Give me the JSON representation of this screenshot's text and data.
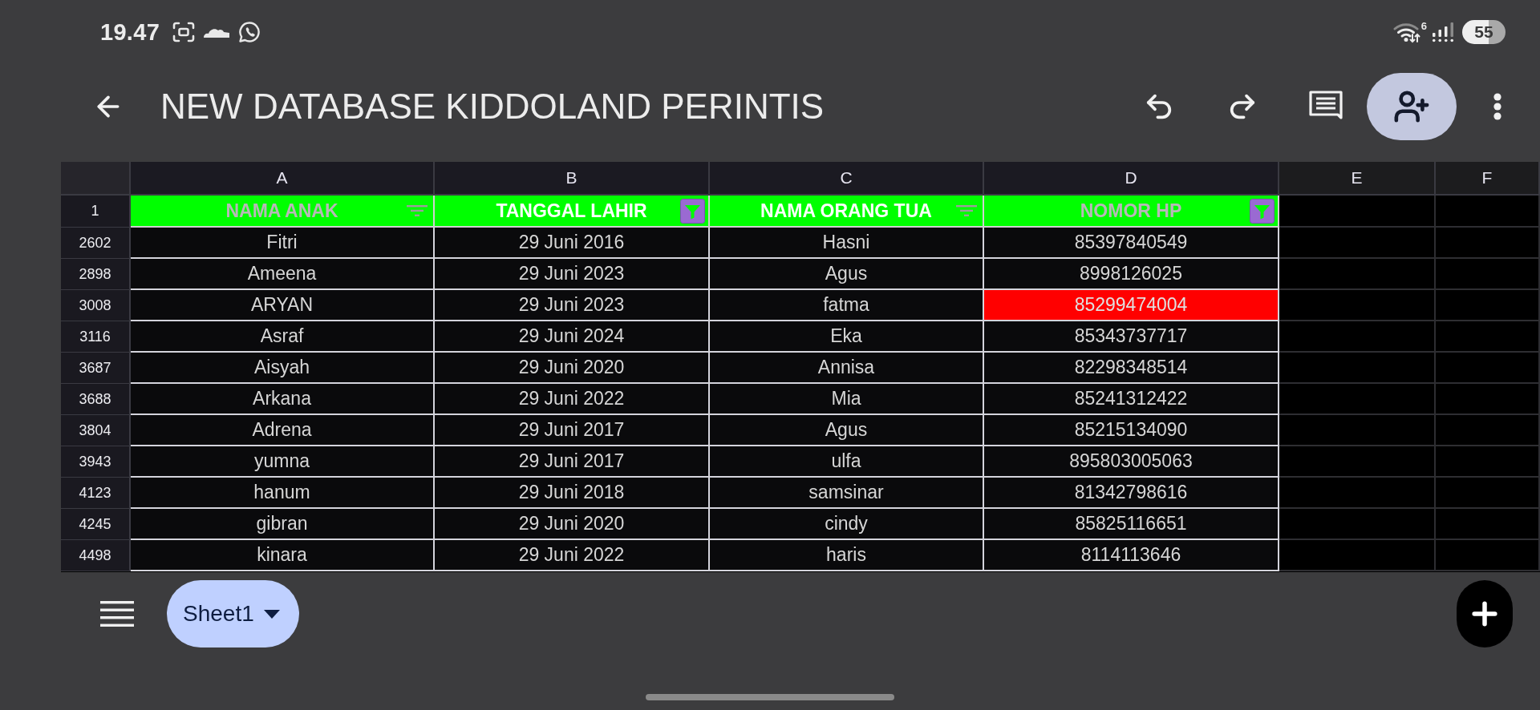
{
  "status_bar": {
    "time": "19.47",
    "network_badge": "6",
    "battery": "55"
  },
  "toolbar": {
    "title": "NEW DATABASE KIDDOLAND PERINTIS"
  },
  "sheet": {
    "columns": [
      "A",
      "B",
      "C",
      "D",
      "E",
      "F"
    ],
    "header_row": {
      "row": "1",
      "cells": [
        {
          "text": "NAMA ANAK",
          "color": "#b8b8b8",
          "filter_active": false
        },
        {
          "text": "TANGGAL LAHIR",
          "color": "#ffffff",
          "filter_active": true
        },
        {
          "text": "NAMA ORANG TUA",
          "color": "#ffffff",
          "filter_active": false
        },
        {
          "text": "NOMOR HP",
          "color": "#b8b8b8",
          "filter_active": true
        }
      ]
    },
    "rows": [
      {
        "row": "2602",
        "cells": [
          {
            "text": "Fitri",
            "highlighted": false
          },
          {
            "text": "29 Juni 2016",
            "highlighted": false
          },
          {
            "text": "Hasni",
            "highlighted": false
          },
          {
            "text": "85397840549",
            "highlighted": false
          }
        ]
      },
      {
        "row": "2898",
        "cells": [
          {
            "text": "Ameena",
            "highlighted": false
          },
          {
            "text": "29 Juni 2023",
            "highlighted": false
          },
          {
            "text": "Agus",
            "highlighted": false
          },
          {
            "text": "8998126025",
            "highlighted": false
          }
        ]
      },
      {
        "row": "3008",
        "cells": [
          {
            "text": "ARYAN",
            "highlighted": false
          },
          {
            "text": "29 Juni 2023",
            "highlighted": false
          },
          {
            "text": "fatma",
            "highlighted": false
          },
          {
            "text": "85299474004",
            "highlighted": true
          }
        ]
      },
      {
        "row": "3116",
        "cells": [
          {
            "text": "Asraf",
            "highlighted": false
          },
          {
            "text": "29 Juni 2024",
            "highlighted": false
          },
          {
            "text": "Eka",
            "highlighted": false
          },
          {
            "text": "85343737717",
            "highlighted": false
          }
        ]
      },
      {
        "row": "3687",
        "cells": [
          {
            "text": "Aisyah",
            "highlighted": false
          },
          {
            "text": "29 Juni 2020",
            "highlighted": false
          },
          {
            "text": "Annisa",
            "highlighted": false
          },
          {
            "text": "82298348514",
            "highlighted": false
          }
        ]
      },
      {
        "row": "3688",
        "cells": [
          {
            "text": "Arkana",
            "highlighted": false
          },
          {
            "text": "29 Juni 2022",
            "highlighted": false
          },
          {
            "text": "Mia",
            "highlighted": false
          },
          {
            "text": "85241312422",
            "highlighted": false
          }
        ]
      },
      {
        "row": "3804",
        "cells": [
          {
            "text": "Adrena",
            "highlighted": false
          },
          {
            "text": "29 Juni 2017",
            "highlighted": false
          },
          {
            "text": "Agus",
            "highlighted": false
          },
          {
            "text": "85215134090",
            "highlighted": false
          }
        ]
      },
      {
        "row": "3943",
        "cells": [
          {
            "text": "yumna",
            "highlighted": false
          },
          {
            "text": "29 Juni 2017",
            "highlighted": false
          },
          {
            "text": "ulfa",
            "highlighted": false
          },
          {
            "text": "895803005063",
            "highlighted": false
          }
        ]
      },
      {
        "row": "4123",
        "cells": [
          {
            "text": "hanum",
            "highlighted": false
          },
          {
            "text": "29 Juni 2018",
            "highlighted": false
          },
          {
            "text": "samsinar",
            "highlighted": false
          },
          {
            "text": "81342798616",
            "highlighted": false
          }
        ]
      },
      {
        "row": "4245",
        "cells": [
          {
            "text": "gibran",
            "highlighted": false
          },
          {
            "text": "29 Juni 2020",
            "highlighted": false
          },
          {
            "text": "cindy",
            "highlighted": false
          },
          {
            "text": "85825116651",
            "highlighted": false
          }
        ]
      },
      {
        "row": "4498",
        "cells": [
          {
            "text": "kinara",
            "highlighted": false
          },
          {
            "text": "29 Juni 2022",
            "highlighted": false
          },
          {
            "text": "haris",
            "highlighted": false
          },
          {
            "text": "8114113646",
            "highlighted": false
          }
        ]
      }
    ]
  },
  "bottom_bar": {
    "sheet_tabs": [
      {
        "label": "Sheet1",
        "selected": true
      }
    ]
  }
}
